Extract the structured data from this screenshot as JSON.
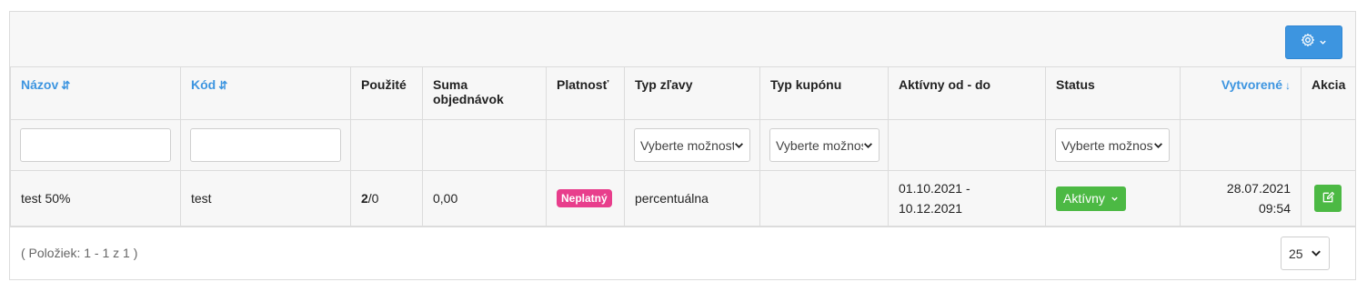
{
  "toolbar": {
    "settings_icon": "gear-icon",
    "dropdown_icon": "chevron-down-icon"
  },
  "table": {
    "columns": [
      {
        "label": "Názov",
        "sort_icon": "⇵"
      },
      {
        "label": "Kód",
        "sort_icon": "⇵"
      },
      {
        "label": "Použité"
      },
      {
        "label": "Suma objednávok"
      },
      {
        "label": "Platnosť"
      },
      {
        "label": "Typ zľavy"
      },
      {
        "label": "Typ kupónu"
      },
      {
        "label": "Aktívny od - do"
      },
      {
        "label": "Status"
      },
      {
        "label": "Vytvorené",
        "sort_icon": "↓"
      },
      {
        "label": "Akcia"
      }
    ],
    "filters": {
      "nazov_value": "",
      "kod_value": "",
      "typ_zlavy_select": "Vyberte možnosť",
      "typ_kuponu_select": "Vyberte možnosť",
      "status_select": "Vyberte možnosť"
    },
    "rows": [
      {
        "nazov": "test 50%",
        "kod": "test",
        "pouzite_used": "2",
        "pouzite_rest": "/0",
        "suma": "0,00",
        "platnost": "Neplatný",
        "typ_zlavy": "percentuálna",
        "typ_kuponu": "",
        "aktivny_od": "01.10.2021 -",
        "aktivny_do": "10.12.2021",
        "status": "Aktívny",
        "vytvorene_date": "28.07.2021",
        "vytvorene_time": "09:54"
      }
    ]
  },
  "footer": {
    "count": "( Položiek: 1 - 1 z 1 )",
    "page_size": "25"
  },
  "colors": {
    "accent": "#3d95e0",
    "success": "#4cb944",
    "danger_pink": "#e83e8c",
    "border": "#dcdcdc"
  }
}
